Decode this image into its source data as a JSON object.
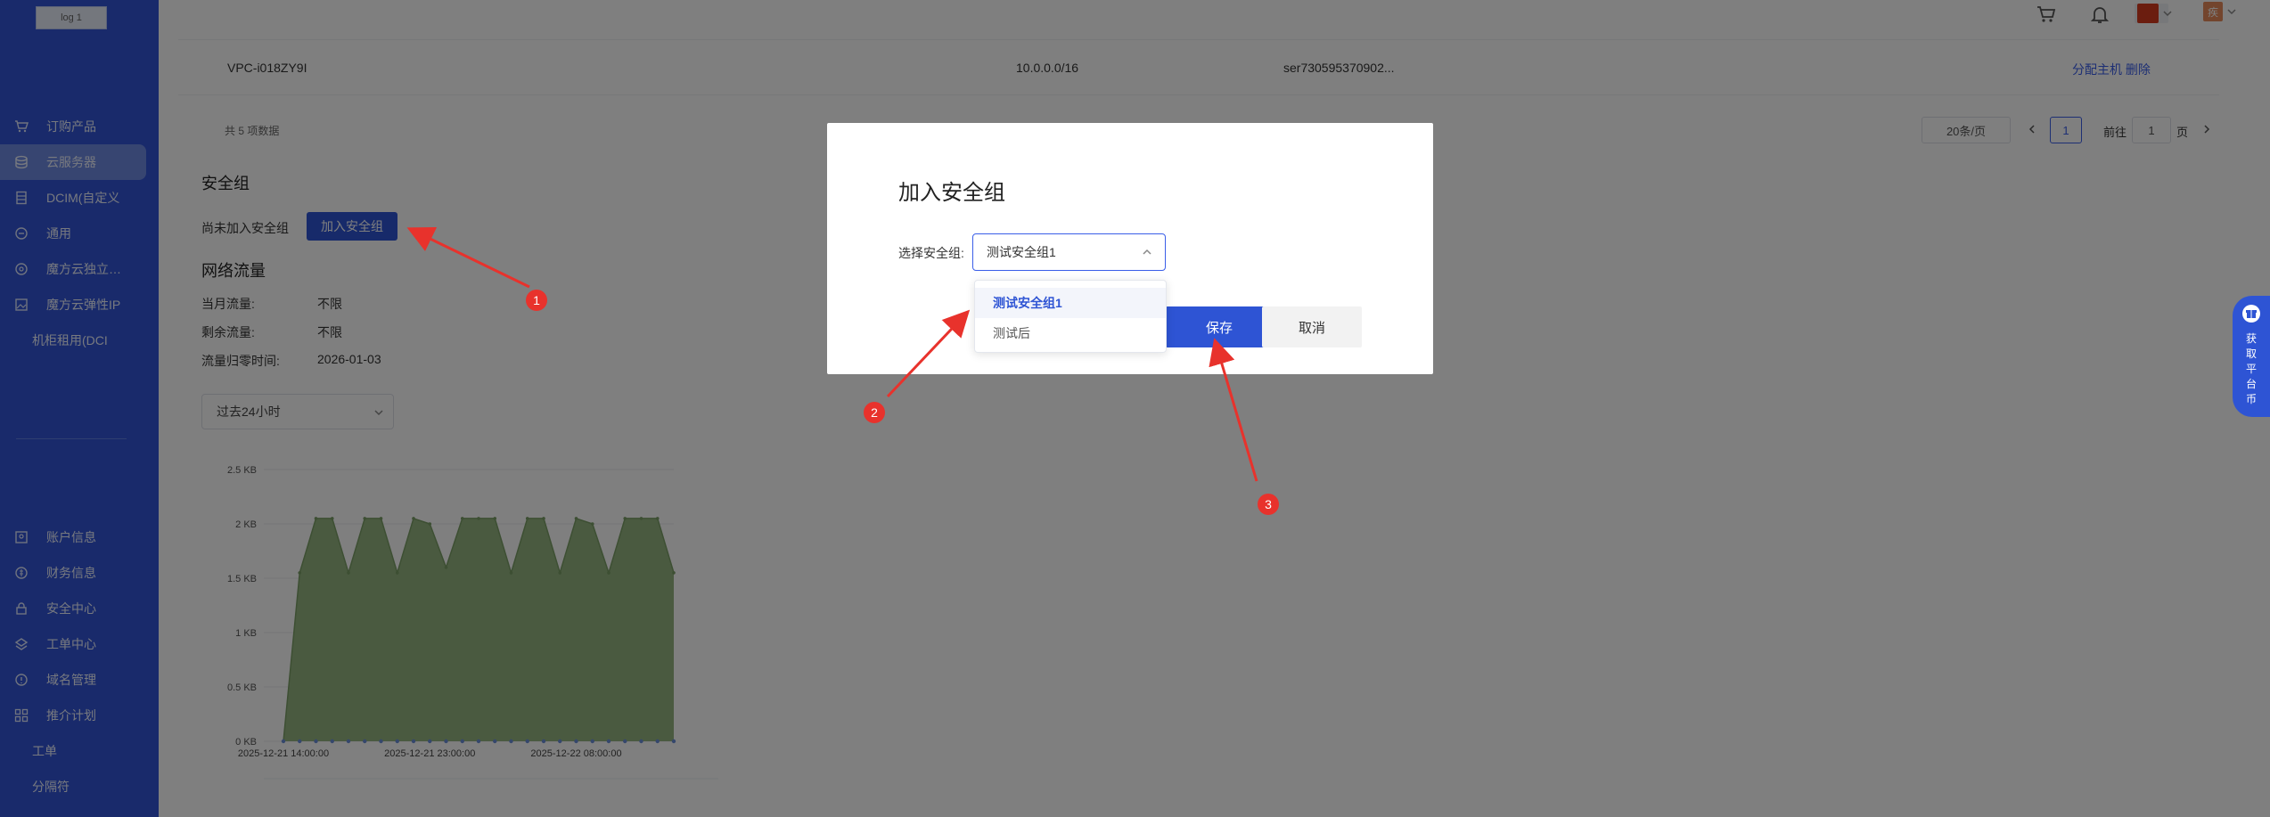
{
  "sidebar": {
    "logo_text": "log 1",
    "top_items": [
      {
        "label": "订购产品",
        "icon": "cart-icon"
      },
      {
        "label": "云服务器",
        "icon": "database-icon",
        "active": true
      },
      {
        "label": "DCIM(自定义",
        "icon": "server-icon"
      },
      {
        "label": "通用",
        "icon": "circle-icon"
      },
      {
        "label": "魔方云独立…",
        "icon": "globe-icon"
      },
      {
        "label": "魔方云弹性IP",
        "icon": "image-icon"
      },
      {
        "label": "机柜租用(DCI",
        "icon": ""
      }
    ],
    "bottom_items": [
      {
        "label": "账户信息",
        "icon": "user-icon"
      },
      {
        "label": "财务信息",
        "icon": "money-icon"
      },
      {
        "label": "安全中心",
        "icon": "lock-icon"
      },
      {
        "label": "工单中心",
        "icon": "ticket-icon"
      },
      {
        "label": "域名管理",
        "icon": "info-icon"
      },
      {
        "label": "推介计划",
        "icon": "grid-icon"
      },
      {
        "label": "工单",
        "icon": ""
      },
      {
        "label": "分隔符",
        "icon": ""
      }
    ]
  },
  "header": {
    "avatar_text": "疾"
  },
  "vpc_row": {
    "name": "VPC-i018ZY9I",
    "cidr": "10.0.0.0/16",
    "server": "ser730595370902...",
    "actions": "分配主机 删除"
  },
  "pagination": {
    "total_text": "共 5 项数据",
    "page_size": "20条/页",
    "current_page": "1",
    "goto_label": "前往",
    "goto_value": "1",
    "page_suffix": "页"
  },
  "security_group": {
    "title": "安全组",
    "status_text": "尚未加入安全组",
    "join_button": "加入安全组"
  },
  "traffic": {
    "title": "网络流量",
    "rows": [
      {
        "label": "当月流量:",
        "value": "不限"
      },
      {
        "label": "剩余流量:",
        "value": "不限"
      },
      {
        "label": "流量归零时间:",
        "value": "2026-01-03"
      }
    ],
    "range_select": "过去24小时"
  },
  "chart_data": {
    "type": "area",
    "y_ticks": [
      "0 KB",
      "0.5 KB",
      "1 KB",
      "1.5 KB",
      "2 KB",
      "2.5 KB"
    ],
    "ylim": [
      0,
      2.5
    ],
    "x_tick_labels": [
      "2025-12-21 14:00:00",
      "2025-12-21 23:00:00",
      "2025-12-22 08:00:00"
    ],
    "x_tick_index": [
      0,
      9,
      18
    ],
    "series": [
      {
        "values": [
          0,
          1.55,
          2.05,
          2.05,
          1.55,
          2.05,
          2.05,
          1.55,
          2.05,
          2.0,
          1.6,
          2.05,
          2.05,
          2.05,
          1.55,
          2.05,
          2.05,
          1.55,
          2.05,
          2.0,
          1.55,
          2.05,
          2.05,
          2.05,
          1.55
        ],
        "secondary": [
          0,
          0,
          0,
          0,
          0,
          0,
          0,
          0,
          0,
          0,
          0,
          0,
          0,
          0,
          0,
          0,
          0,
          0,
          0,
          0,
          0,
          0,
          0,
          0,
          0
        ]
      }
    ],
    "colors": {
      "fill": "#8fb07a",
      "line": "#7a9e66",
      "secondary": "#6a8fd8"
    }
  },
  "modal": {
    "title": "加入安全组",
    "field_label": "选择安全组:",
    "selected_value": "测试安全组1",
    "options": [
      "测试安全组1",
      "测试后"
    ],
    "save_label": "保存",
    "cancel_label": "取消"
  },
  "annotations": [
    "1",
    "2",
    "3"
  ],
  "float_tab": {
    "text": "获取平台币"
  },
  "colors": {
    "primary": "#2e54d4",
    "annotation": "#e8322c"
  }
}
